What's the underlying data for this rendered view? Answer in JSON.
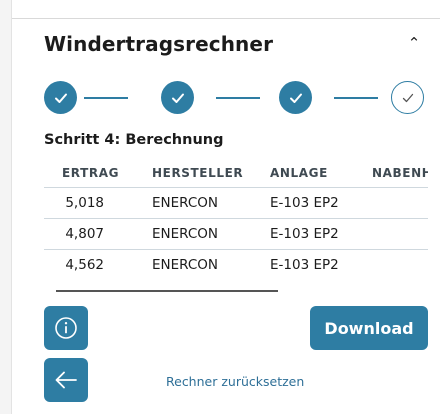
{
  "header": {
    "title": "Windertragsrechner",
    "collapse_icon": "chevron-up-icon"
  },
  "stepper": {
    "steps": [
      {
        "state": "done",
        "icon": "check-icon"
      },
      {
        "state": "done",
        "icon": "check-icon"
      },
      {
        "state": "done",
        "icon": "check-icon"
      },
      {
        "state": "current",
        "icon": "check-icon"
      }
    ],
    "accent": "#2e7da3"
  },
  "section": {
    "title": "Schritt 4: Berechnung"
  },
  "table": {
    "columns": [
      "ERTRAG",
      "HERSTELLER",
      "ANLAGE",
      "NABENH"
    ],
    "rows": [
      [
        "5,018",
        "ENERCON",
        "E-103 EP2"
      ],
      [
        "4,807",
        "ENERCON",
        "E-103 EP2"
      ],
      [
        "4,562",
        "ENERCON",
        "E-103 EP2"
      ]
    ]
  },
  "actions": {
    "info_icon": "info-icon",
    "download_label": "Download",
    "back_icon": "arrow-left-icon",
    "reset_label": "Rechner zurücksetzen"
  }
}
